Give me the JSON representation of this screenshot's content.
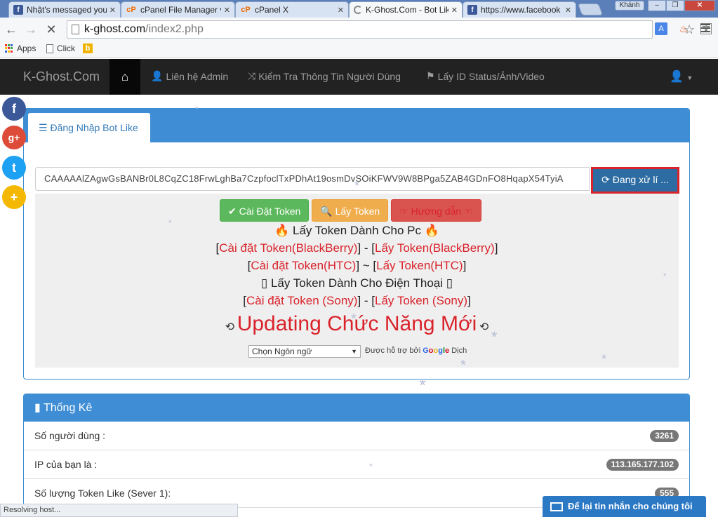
{
  "browser": {
    "tabs": [
      {
        "icon": "facebook-icon",
        "title": "Nhật's messaged you",
        "close": "✕"
      },
      {
        "icon": "cpanel-icon",
        "title": "cPanel File Manager v3",
        "close": "✕"
      },
      {
        "icon": "cpanel-icon",
        "title": "cPanel X",
        "close": "✕"
      },
      {
        "icon": "loading-icon",
        "title": "K-Ghost.Com - Bot Like",
        "close": "✕"
      },
      {
        "icon": "facebook-icon",
        "title": "https://www.facebook",
        "close": "✕"
      }
    ],
    "profile_name": "Khánh",
    "url_host": "k-ghost.com",
    "url_path": "/index2.php",
    "bookmarks": [
      "Apps",
      "Click"
    ],
    "status_text": "Resolving host..."
  },
  "site_nav": {
    "brand": "K-Ghost.Com",
    "links": [
      "Liên hệ Admin",
      "Kiểm Tra Thông Tin Người Dùng",
      "Lấy ID Status/Ảnh/Video"
    ]
  },
  "social": [
    "f",
    "g+",
    "t",
    "+"
  ],
  "login": {
    "tab_label": "Đăng Nhập Bot Like",
    "token_value": "CAAAAAlZAgwGsBANBr0L8CqZC18FrwLghBa7CzpfoclTxPDhAt19osmDvSOiKFWV9W8BPga5ZAB4GDnFO8HqapX54TyiA",
    "processing_label": "Đang xử lí ...",
    "buttons": {
      "install": "Cài Đặt Token",
      "get": "Lấy Token",
      "guide": "Hướng dẫn"
    },
    "pc_heading": "Lấy Token Dành Cho Pc",
    "blackberry_install": "Cài đặt Token(BlackBerry)",
    "blackberry_get": "Lấy Token(BlackBerry)",
    "htc_install": "Cài đặt Token(HTC)",
    "htc_get": "Lấy Token(HTC)",
    "phone_heading": "Lấy Token Dành Cho Điện Thoại",
    "sony_install": "Cài đặt Token (Sony)",
    "sony_get": "Lấy Token (Sony)",
    "updating": "Updating Chức Năng Mới",
    "language_select": "Chọn Ngôn ngữ",
    "powered_by": "Được hỗ trợ bởi",
    "translate": "Dịch"
  },
  "stats": {
    "title": "Thống Kê",
    "rows": [
      {
        "label": "Số người dùng :",
        "value": "3261"
      },
      {
        "label": "IP của bạn là :",
        "value": "113.165.177.102"
      },
      {
        "label": "Số lượng Token Like (Sever 1):",
        "value": "555"
      }
    ]
  },
  "chat_label": "Để lại tin nhắn cho chúng tôi"
}
